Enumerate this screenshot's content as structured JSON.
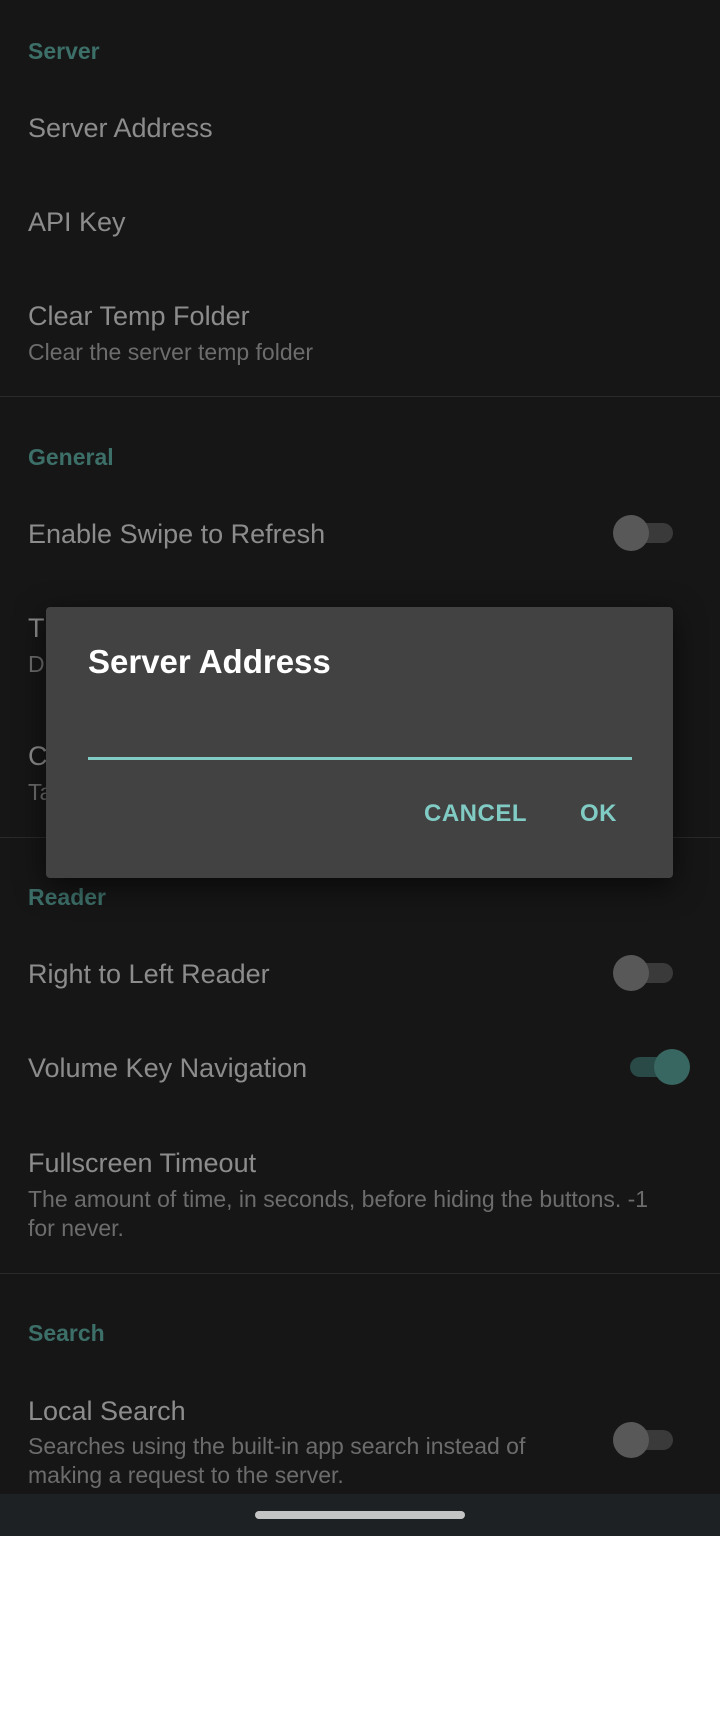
{
  "sections": {
    "server": {
      "header": "Server",
      "server_address": "Server Address",
      "api_key": "API Key",
      "clear_temp_title": "Clear Temp Folder",
      "clear_temp_summary": "Clear the server temp folder"
    },
    "general": {
      "header": "General",
      "swipe_refresh_title": "Enable Swipe to Refresh",
      "swipe_refresh_on": false,
      "partial_item_1_title": "T",
      "partial_item_1_summary": "D",
      "partial_item_2_title": "C",
      "partial_item_2_summary": "Ta"
    },
    "reader": {
      "header": "Reader",
      "rtl_title": "Right to Left Reader",
      "rtl_on": false,
      "volume_key_title": "Volume Key Navigation",
      "volume_key_on": true,
      "fullscreen_title": "Fullscreen Timeout",
      "fullscreen_summary": "The amount of time, in seconds, before hiding the buttons. -1 for never."
    },
    "search": {
      "header": "Search",
      "local_search_title": "Local Search",
      "local_search_summary": "Searches using the built-in app search instead of making a request to the server.",
      "local_search_on": false
    }
  },
  "dialog": {
    "title": "Server Address",
    "input_value": "",
    "cancel_label": "CANCEL",
    "ok_label": "OK"
  },
  "colors": {
    "accent": "#80cbc4",
    "background": "#161616",
    "dialog_background": "#424242"
  }
}
